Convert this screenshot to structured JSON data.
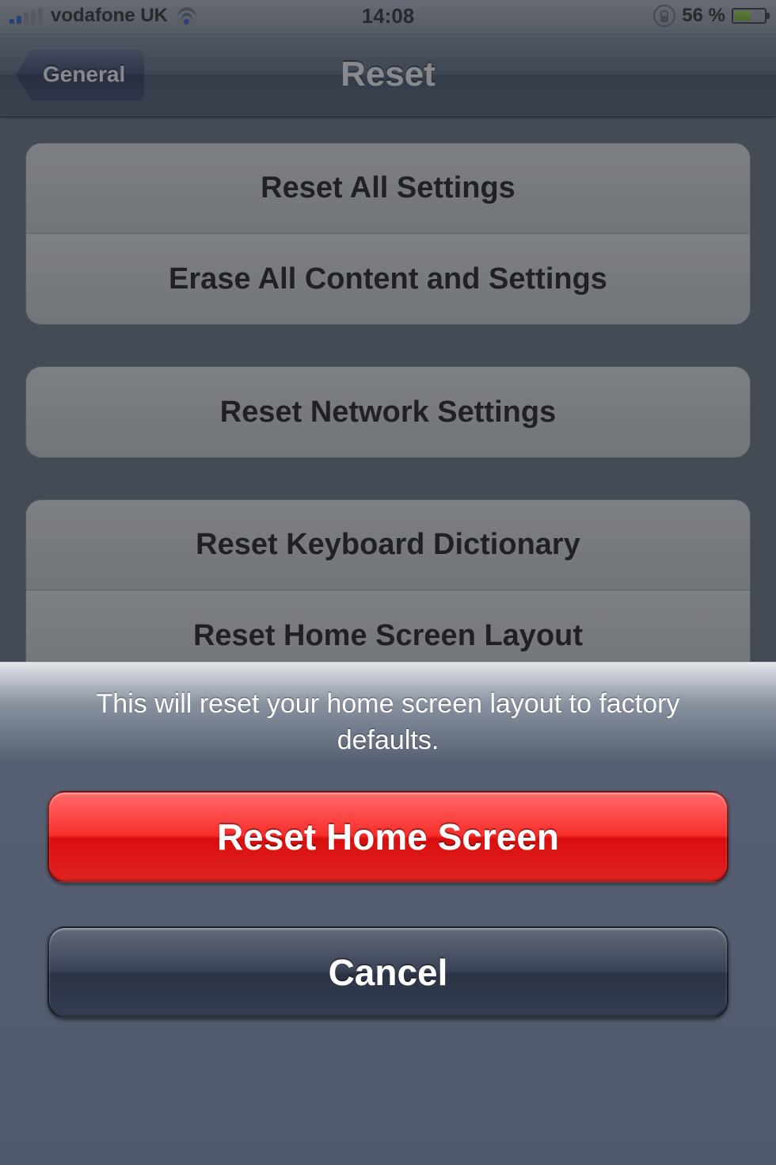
{
  "status_bar": {
    "carrier": "vodafone UK",
    "time": "14:08",
    "battery_percent": "56 %"
  },
  "nav": {
    "back_label": "General",
    "title": "Reset"
  },
  "groups": [
    {
      "rows": [
        "Reset All Settings",
        "Erase All Content and Settings"
      ]
    },
    {
      "rows": [
        "Reset Network Settings"
      ]
    },
    {
      "rows": [
        "Reset Keyboard Dictionary",
        "Reset Home Screen Layout"
      ]
    }
  ],
  "action_sheet": {
    "message": "This will reset your home screen layout to factory defaults.",
    "destructive_label": "Reset Home Screen",
    "cancel_label": "Cancel"
  }
}
